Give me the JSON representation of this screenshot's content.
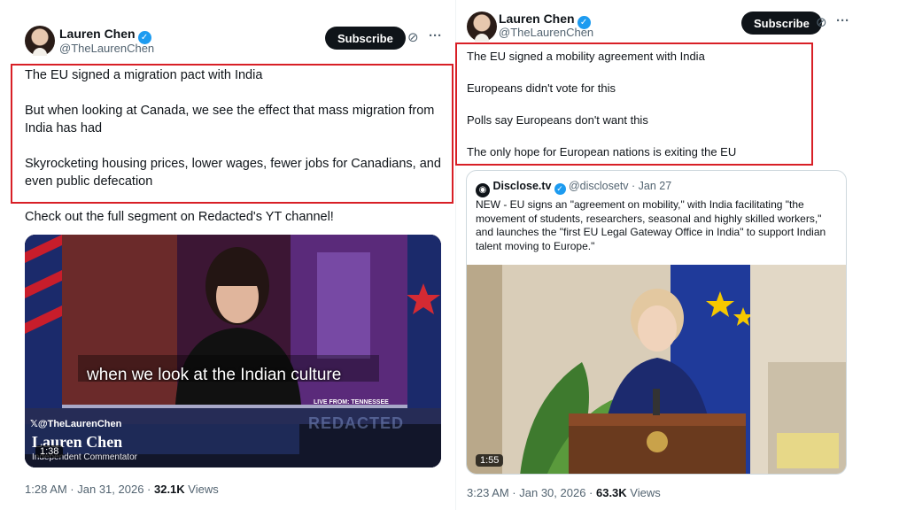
{
  "left": {
    "author_name": "Lauren Chen",
    "author_handle": "@TheLaurenChen",
    "subscribe_label": "Subscribe",
    "more_icon": "more-icon",
    "grok_icon": "grok-icon",
    "lines": [
      "The EU signed a migration pact with India",
      "But when looking at Canada, we see the effect that mass migration from India has had",
      "Skyrocketing housing prices, lower wages, fewer jobs for Canadians, and even public defecation"
    ],
    "extra_line": "Check out the full segment on Redacted's YT channel!",
    "video": {
      "caption": "when we look at the Indian culture",
      "live_from": "LIVE FROM: TENNESSEE",
      "overlay_handle": "@TheLaurenChen",
      "overlay_name": "Lauren Chen",
      "overlay_title": "Independent Commentator",
      "watermark": "REDACTED",
      "duration": "1:38"
    },
    "timestamp": "1:28 AM · Jan 31, 2026 · ",
    "views_count": "32.1K",
    "views_label": " Views"
  },
  "right": {
    "author_name": "Lauren Chen",
    "author_handle": "@TheLaurenChen",
    "subscribe_label": "Subscribe",
    "lines": [
      "The EU signed a mobility agreement with India",
      "Europeans didn't vote for this",
      "Polls say Europeans don't want this",
      "The only hope for European nations is exiting the EU"
    ],
    "quote": {
      "name": "Disclose.tv",
      "handle": "@disclosetv · Jan 27",
      "text": "NEW - EU signs an \"agreement on mobility,\" with India  facilitating \"the movement of students, researchers, seasonal and highly skilled workers,\" and launches the \"first EU Legal Gateway Office in India\" to support Indian talent moving to Europe.\"",
      "duration": "1:55"
    },
    "timestamp": "3:23 AM · Jan 30, 2026 · ",
    "views_count": "63.3K",
    "views_label": " Views"
  },
  "colors": {
    "highlight_box": "#d81f26",
    "verified": "#1d9bf0",
    "subscribe_bg": "#0f1419",
    "secondary_text": "#536471"
  }
}
